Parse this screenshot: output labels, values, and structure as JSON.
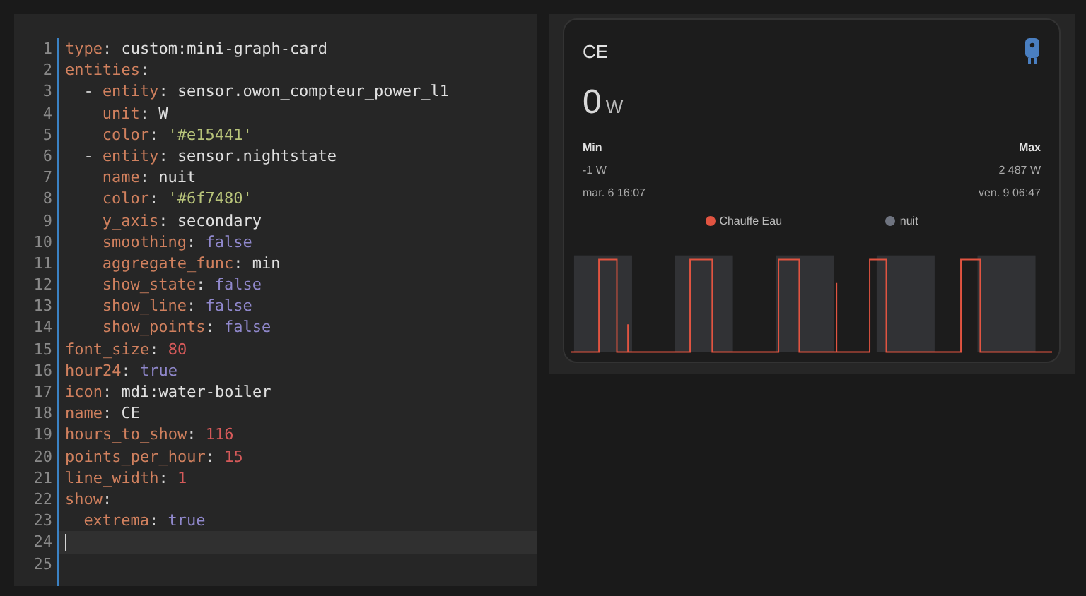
{
  "editor": {
    "lines": [
      {
        "number": "1",
        "kind": "root",
        "tokens": [
          {
            "text": "type",
            "kind": "key"
          },
          {
            "text": ": ",
            "kind": "punct"
          },
          {
            "text": "custom:mini-graph-card",
            "kind": "plain"
          }
        ]
      },
      {
        "number": "2",
        "kind": "root",
        "tokens": [
          {
            "text": "entities",
            "kind": "key"
          },
          {
            "text": ":",
            "kind": "punct"
          }
        ]
      },
      {
        "number": "3",
        "kind": "item",
        "tokens": [
          {
            "text": "- ",
            "kind": "punct"
          },
          {
            "text": "entity",
            "kind": "key"
          },
          {
            "text": ": ",
            "kind": "punct"
          },
          {
            "text": "sensor.owon_compteur_power_l1",
            "kind": "plain"
          }
        ]
      },
      {
        "number": "4",
        "kind": "field",
        "tokens": [
          {
            "text": "unit",
            "kind": "key"
          },
          {
            "text": ": ",
            "kind": "punct"
          },
          {
            "text": "W",
            "kind": "plain"
          }
        ]
      },
      {
        "number": "5",
        "kind": "field",
        "tokens": [
          {
            "text": "color",
            "kind": "key"
          },
          {
            "text": ": ",
            "kind": "punct"
          },
          {
            "text": "'#e15441'",
            "kind": "string"
          }
        ]
      },
      {
        "number": "6",
        "kind": "item",
        "tokens": [
          {
            "text": "- ",
            "kind": "punct"
          },
          {
            "text": "entity",
            "kind": "key"
          },
          {
            "text": ": ",
            "kind": "punct"
          },
          {
            "text": "sensor.nightstate",
            "kind": "plain"
          }
        ]
      },
      {
        "number": "7",
        "kind": "field",
        "tokens": [
          {
            "text": "name",
            "kind": "key"
          },
          {
            "text": ": ",
            "kind": "punct"
          },
          {
            "text": "nuit",
            "kind": "plain"
          }
        ]
      },
      {
        "number": "8",
        "kind": "field",
        "tokens": [
          {
            "text": "color",
            "kind": "key"
          },
          {
            "text": ": ",
            "kind": "punct"
          },
          {
            "text": "'#6f7480'",
            "kind": "string"
          }
        ]
      },
      {
        "number": "9",
        "kind": "field",
        "tokens": [
          {
            "text": "y_axis",
            "kind": "key"
          },
          {
            "text": ": ",
            "kind": "punct"
          },
          {
            "text": "secondary",
            "kind": "plain"
          }
        ]
      },
      {
        "number": "10",
        "kind": "field",
        "tokens": [
          {
            "text": "smoothing",
            "kind": "key"
          },
          {
            "text": ": ",
            "kind": "punct"
          },
          {
            "text": "false",
            "kind": "bool"
          }
        ]
      },
      {
        "number": "11",
        "kind": "field",
        "tokens": [
          {
            "text": "aggregate_func",
            "kind": "key"
          },
          {
            "text": ": ",
            "kind": "punct"
          },
          {
            "text": "min",
            "kind": "plain"
          }
        ]
      },
      {
        "number": "12",
        "kind": "field",
        "tokens": [
          {
            "text": "show_state",
            "kind": "key"
          },
          {
            "text": ": ",
            "kind": "punct"
          },
          {
            "text": "false",
            "kind": "bool"
          }
        ]
      },
      {
        "number": "13",
        "kind": "field",
        "tokens": [
          {
            "text": "show_line",
            "kind": "key"
          },
          {
            "text": ": ",
            "kind": "punct"
          },
          {
            "text": "false",
            "kind": "bool"
          }
        ]
      },
      {
        "number": "14",
        "kind": "field",
        "tokens": [
          {
            "text": "show_points",
            "kind": "key"
          },
          {
            "text": ": ",
            "kind": "punct"
          },
          {
            "text": "false",
            "kind": "bool"
          }
        ]
      },
      {
        "number": "15",
        "kind": "root",
        "tokens": [
          {
            "text": "font_size",
            "kind": "key"
          },
          {
            "text": ": ",
            "kind": "punct"
          },
          {
            "text": "80",
            "kind": "number"
          }
        ]
      },
      {
        "number": "16",
        "kind": "root",
        "tokens": [
          {
            "text": "hour24",
            "kind": "key"
          },
          {
            "text": ": ",
            "kind": "punct"
          },
          {
            "text": "true",
            "kind": "bool"
          }
        ]
      },
      {
        "number": "17",
        "kind": "root",
        "tokens": [
          {
            "text": "icon",
            "kind": "key"
          },
          {
            "text": ": ",
            "kind": "punct"
          },
          {
            "text": "mdi:water-boiler",
            "kind": "plain"
          }
        ]
      },
      {
        "number": "18",
        "kind": "root",
        "tokens": [
          {
            "text": "name",
            "kind": "key"
          },
          {
            "text": ": ",
            "kind": "punct"
          },
          {
            "text": "CE",
            "kind": "plain"
          }
        ]
      },
      {
        "number": "19",
        "kind": "root",
        "tokens": [
          {
            "text": "hours_to_show",
            "kind": "key"
          },
          {
            "text": ": ",
            "kind": "punct"
          },
          {
            "text": "116",
            "kind": "number"
          }
        ]
      },
      {
        "number": "20",
        "kind": "root",
        "tokens": [
          {
            "text": "points_per_hour",
            "kind": "key"
          },
          {
            "text": ": ",
            "kind": "punct"
          },
          {
            "text": "15",
            "kind": "number"
          }
        ]
      },
      {
        "number": "21",
        "kind": "root",
        "tokens": [
          {
            "text": "line_width",
            "kind": "key"
          },
          {
            "text": ": ",
            "kind": "punct"
          },
          {
            "text": "1",
            "kind": "number"
          }
        ]
      },
      {
        "number": "22",
        "kind": "root",
        "tokens": [
          {
            "text": "show",
            "kind": "key"
          },
          {
            "text": ":",
            "kind": "punct"
          }
        ]
      },
      {
        "number": "23",
        "kind": "item",
        "tokens": [
          {
            "text": "extrema",
            "kind": "key"
          },
          {
            "text": ": ",
            "kind": "punct"
          },
          {
            "text": "true",
            "kind": "bool"
          }
        ]
      },
      {
        "number": "24",
        "kind": "root",
        "selected": true
      },
      {
        "number": "25",
        "kind": "root"
      }
    ]
  },
  "card": {
    "title": "CE",
    "value": "0",
    "unit": "W",
    "min": {
      "label": "Min",
      "value": "-1 W",
      "time": "mar. 6 16:07"
    },
    "max": {
      "label": "Max",
      "value": "2 487 W",
      "time": "ven. 9 06:47"
    },
    "legend": [
      {
        "name": "Chauffe Eau",
        "color": "#e15441"
      },
      {
        "name": "nuit",
        "color": "#6f7480"
      }
    ]
  }
}
